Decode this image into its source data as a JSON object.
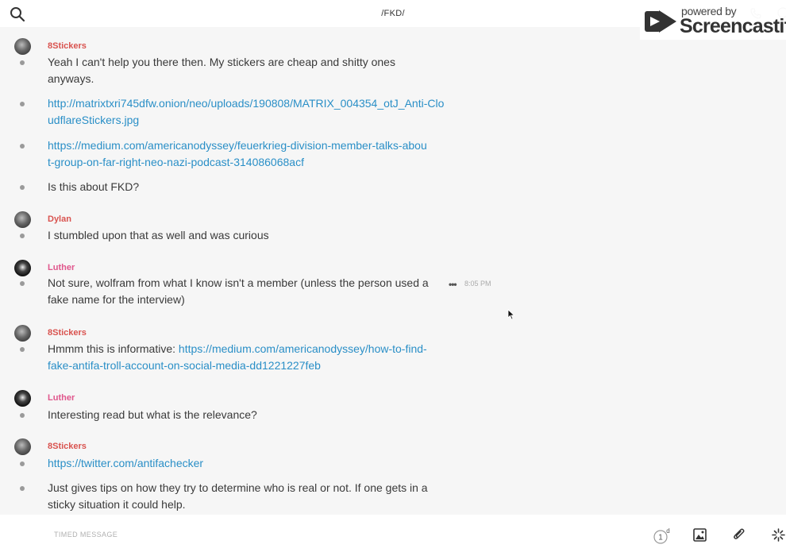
{
  "header": {
    "title": "/FKD/",
    "watermark": {
      "powered": "powered by",
      "brand": "Screencastify"
    }
  },
  "messages": [
    {
      "sender": "8Stickers",
      "items": [
        {
          "text": "Yeah I can't help you there then. My stickers are cheap and shitty ones anyways."
        },
        {
          "link": "http://matrixtxri745dfw.onion/neo/uploads/190808/MATRIX_004354_otJ_Anti-CloudflareStickers.jpg"
        },
        {
          "link": "https://medium.com/americanodyssey/feuerkrieg-division-member-talks-about-group-on-far-right-neo-nazi-podcast-314086068acf"
        },
        {
          "text": "Is this about FKD?"
        }
      ]
    },
    {
      "sender": "Dylan",
      "items": [
        {
          "text": "I stumbled upon that as well and was curious"
        }
      ]
    },
    {
      "sender": "Luther",
      "items": [
        {
          "text": "Not sure, wolfram from what I know isn't a member (unless the person used a fake name for the interview)",
          "time": "8:05 PM"
        }
      ]
    },
    {
      "sender": "8Stickers",
      "items": [
        {
          "text": "Hmmm this is informative: ",
          "link": "https://medium.com/americanodyssey/how-to-find-fake-antifa-troll-account-on-social-media-dd1221227feb"
        }
      ]
    },
    {
      "sender": "Luther",
      "items": [
        {
          "text": "Interesting read but what is the relevance?"
        }
      ]
    },
    {
      "sender": "8Stickers",
      "items": [
        {
          "link": "https://twitter.com/antifachecker"
        },
        {
          "text": "Just gives tips on how they try to determine who is real or not. If one gets in a sticky situation it could help."
        }
      ]
    }
  ],
  "composer": {
    "placeholder": "TIMED MESSAGE",
    "timer_value": "1",
    "timer_unit": "d"
  },
  "icons": {
    "search": "search-icon",
    "call": "phone-icon",
    "info": "info-icon",
    "image": "image-icon",
    "attach": "paperclip-icon",
    "ping": "ping-icon",
    "more": "more-icon"
  },
  "colors": {
    "sender_red": "#d9534f",
    "sender_pink": "#e0568c",
    "link": "#2a8fc7",
    "background": "#f6f6f6"
  }
}
